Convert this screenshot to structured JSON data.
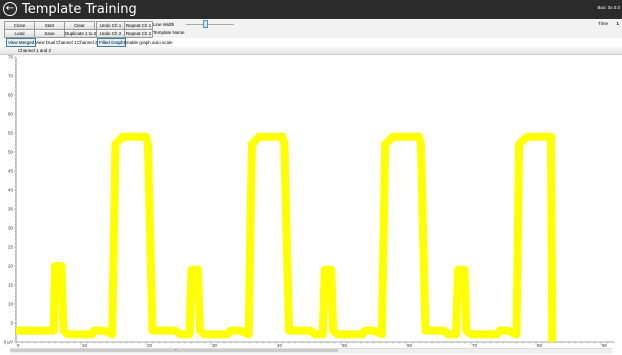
{
  "window": {
    "title": "Template Training",
    "back_icon": "back-arrow-icon",
    "box_info": "Box: 0x  0.0"
  },
  "toolbar": {
    "close": "Close",
    "start": "Start",
    "clear": "Clear",
    "undo_ch1": "Undo Ch 1",
    "repeat_ch1": "Repeat Ch 1",
    "line_width_label": "Line Width",
    "load": "Load",
    "save": "Save",
    "duplicate": "Duplicate 1 to 2",
    "undo_ch2": "Undo Ch 2",
    "repeat_ch2": "Repeat Ch 2",
    "template_name_label": "Template Name",
    "time_label": "Time",
    "time_value": "1"
  },
  "line_width": {
    "value": 0.4
  },
  "view_tabs": {
    "merged": "View Merged",
    "dual": "View Dual",
    "channel1": "Channel 1",
    "channel2": "Channel 2",
    "filled": "Filled Graph",
    "autoscale": "Enable graph auto scale"
  },
  "chart_data": {
    "type": "line",
    "title": "Channel 1 and 2",
    "xlim": [
      0,
      92
    ],
    "ylim": [
      0,
      75
    ],
    "x_ticks": [
      0,
      10,
      20,
      30,
      40,
      50,
      60,
      70,
      80,
      90
    ],
    "x_tick_labels": [
      "0",
      "10",
      "20",
      "30",
      "40",
      "50",
      "60",
      "70",
      "80",
      "90"
    ],
    "y_ticks": [
      0,
      5,
      10,
      15,
      20,
      25,
      30,
      35,
      40,
      45,
      50,
      55,
      60,
      65,
      70,
      75
    ],
    "y_tick_labels": [
      "0 µV",
      "5",
      "10",
      "15",
      "20",
      "25",
      "30",
      "35",
      "40",
      "45",
      "50",
      "55",
      "60",
      "65",
      "70",
      "75"
    ],
    "grid": false,
    "series": [
      {
        "color": "#ffff00",
        "x": [
          0,
          5.8,
          6,
          7,
          7.3,
          8,
          11.7,
          12,
          13.5,
          14.8,
          15.3,
          16.4,
          20,
          20.3,
          21,
          24.5,
          25.3,
          26.7,
          27,
          28,
          28.3,
          29,
          32.5,
          33,
          34.5,
          35.8,
          36.3,
          37.4,
          41,
          41.3,
          42,
          45.3,
          46,
          47.2,
          47.5,
          48.5,
          48.8,
          49.5,
          53.3,
          53.7,
          55,
          56.3,
          56.8,
          58,
          62,
          62.3,
          63,
          65.8,
          66.5,
          67.7,
          68,
          69,
          69.3,
          70,
          74,
          74.4,
          75.7,
          77,
          77.4,
          78.6,
          82.3,
          82.5
        ],
        "y": [
          3,
          3,
          20,
          20,
          3,
          2,
          2,
          3,
          3,
          2,
          52,
          54,
          54,
          52,
          3,
          3,
          2,
          2,
          19,
          19,
          3,
          2,
          2,
          3,
          3,
          2,
          52,
          54,
          54,
          52,
          3,
          3,
          2,
          2,
          19,
          19,
          3,
          2,
          2,
          3,
          3,
          2,
          52,
          54,
          54,
          52,
          3,
          3,
          2,
          2,
          19,
          19,
          3,
          2,
          2,
          3,
          3,
          2,
          52,
          54,
          54,
          0
        ]
      }
    ]
  },
  "scrollbar": {
    "grip_icon": "scroll-grip-icon"
  }
}
